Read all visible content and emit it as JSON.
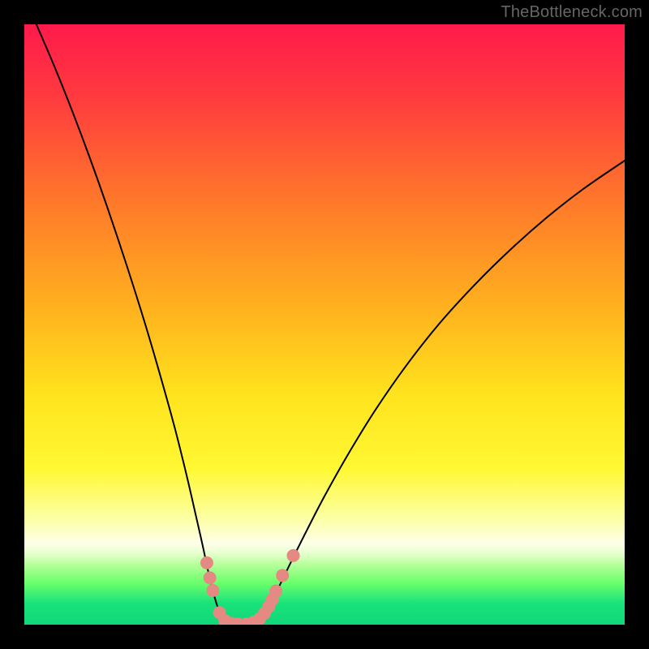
{
  "watermark": "TheBottleneck.com",
  "chart_data": {
    "type": "line",
    "title": "",
    "xlabel": "",
    "ylabel": "",
    "xlim": [
      0,
      100
    ],
    "ylim": [
      0,
      100
    ],
    "background_gradient": {
      "stops": [
        {
          "offset": 0.0,
          "color": "#ff1a4b"
        },
        {
          "offset": 0.12,
          "color": "#ff3a3f"
        },
        {
          "offset": 0.3,
          "color": "#ff7a2a"
        },
        {
          "offset": 0.48,
          "color": "#ffb41e"
        },
        {
          "offset": 0.62,
          "color": "#ffe41e"
        },
        {
          "offset": 0.74,
          "color": "#fff833"
        },
        {
          "offset": 0.82,
          "color": "#fcffa0"
        },
        {
          "offset": 0.865,
          "color": "#feffe8"
        },
        {
          "offset": 0.88,
          "color": "#e8ffd0"
        },
        {
          "offset": 0.9,
          "color": "#b6ff9a"
        },
        {
          "offset": 0.93,
          "color": "#6cff6c"
        },
        {
          "offset": 0.965,
          "color": "#18e27a"
        },
        {
          "offset": 1.0,
          "color": "#11d77a"
        }
      ]
    },
    "series": [
      {
        "name": "curve",
        "color": "#000000",
        "stroke_width": 2,
        "points": [
          {
            "x": 2.0,
            "y": 100.0
          },
          {
            "x": 5.0,
            "y": 93.0
          },
          {
            "x": 8.0,
            "y": 85.5
          },
          {
            "x": 11.0,
            "y": 77.5
          },
          {
            "x": 14.0,
            "y": 69.0
          },
          {
            "x": 17.0,
            "y": 60.0
          },
          {
            "x": 20.0,
            "y": 50.5
          },
          {
            "x": 22.5,
            "y": 42.0
          },
          {
            "x": 25.0,
            "y": 33.0
          },
          {
            "x": 27.0,
            "y": 25.0
          },
          {
            "x": 28.5,
            "y": 18.5
          },
          {
            "x": 29.7,
            "y": 13.2
          },
          {
            "x": 30.6,
            "y": 9.0
          },
          {
            "x": 31.5,
            "y": 5.3
          },
          {
            "x": 32.3,
            "y": 2.7
          },
          {
            "x": 33.3,
            "y": 0.9
          },
          {
            "x": 34.7,
            "y": 0.15
          },
          {
            "x": 36.3,
            "y": 0.05
          },
          {
            "x": 37.8,
            "y": 0.25
          },
          {
            "x": 39.3,
            "y": 1.2
          },
          {
            "x": 40.8,
            "y": 3.2
          },
          {
            "x": 42.5,
            "y": 6.5
          },
          {
            "x": 44.5,
            "y": 10.6
          },
          {
            "x": 47.0,
            "y": 15.6
          },
          {
            "x": 50.0,
            "y": 21.4
          },
          {
            "x": 54.0,
            "y": 28.5
          },
          {
            "x": 58.5,
            "y": 35.8
          },
          {
            "x": 63.5,
            "y": 43.0
          },
          {
            "x": 69.0,
            "y": 50.0
          },
          {
            "x": 75.0,
            "y": 56.6
          },
          {
            "x": 81.0,
            "y": 62.5
          },
          {
            "x": 87.0,
            "y": 67.8
          },
          {
            "x": 93.0,
            "y": 72.5
          },
          {
            "x": 100.0,
            "y": 77.3
          }
        ]
      },
      {
        "name": "markers",
        "type": "scatter",
        "color": "#e58a82",
        "radius": 8,
        "points": [
          {
            "x": 30.4,
            "y": 10.3
          },
          {
            "x": 30.9,
            "y": 7.8
          },
          {
            "x": 31.4,
            "y": 5.7
          },
          {
            "x": 32.5,
            "y": 2.0
          },
          {
            "x": 33.4,
            "y": 0.7
          },
          {
            "x": 34.5,
            "y": 0.2
          },
          {
            "x": 35.6,
            "y": 0.1
          },
          {
            "x": 37.0,
            "y": 0.1
          },
          {
            "x": 38.2,
            "y": 0.4
          },
          {
            "x": 39.2,
            "y": 1.0
          },
          {
            "x": 40.0,
            "y": 1.9
          },
          {
            "x": 40.7,
            "y": 3.0
          },
          {
            "x": 41.3,
            "y": 4.2
          },
          {
            "x": 41.9,
            "y": 5.6
          },
          {
            "x": 43.0,
            "y": 8.2
          },
          {
            "x": 44.8,
            "y": 11.5
          }
        ]
      }
    ]
  }
}
